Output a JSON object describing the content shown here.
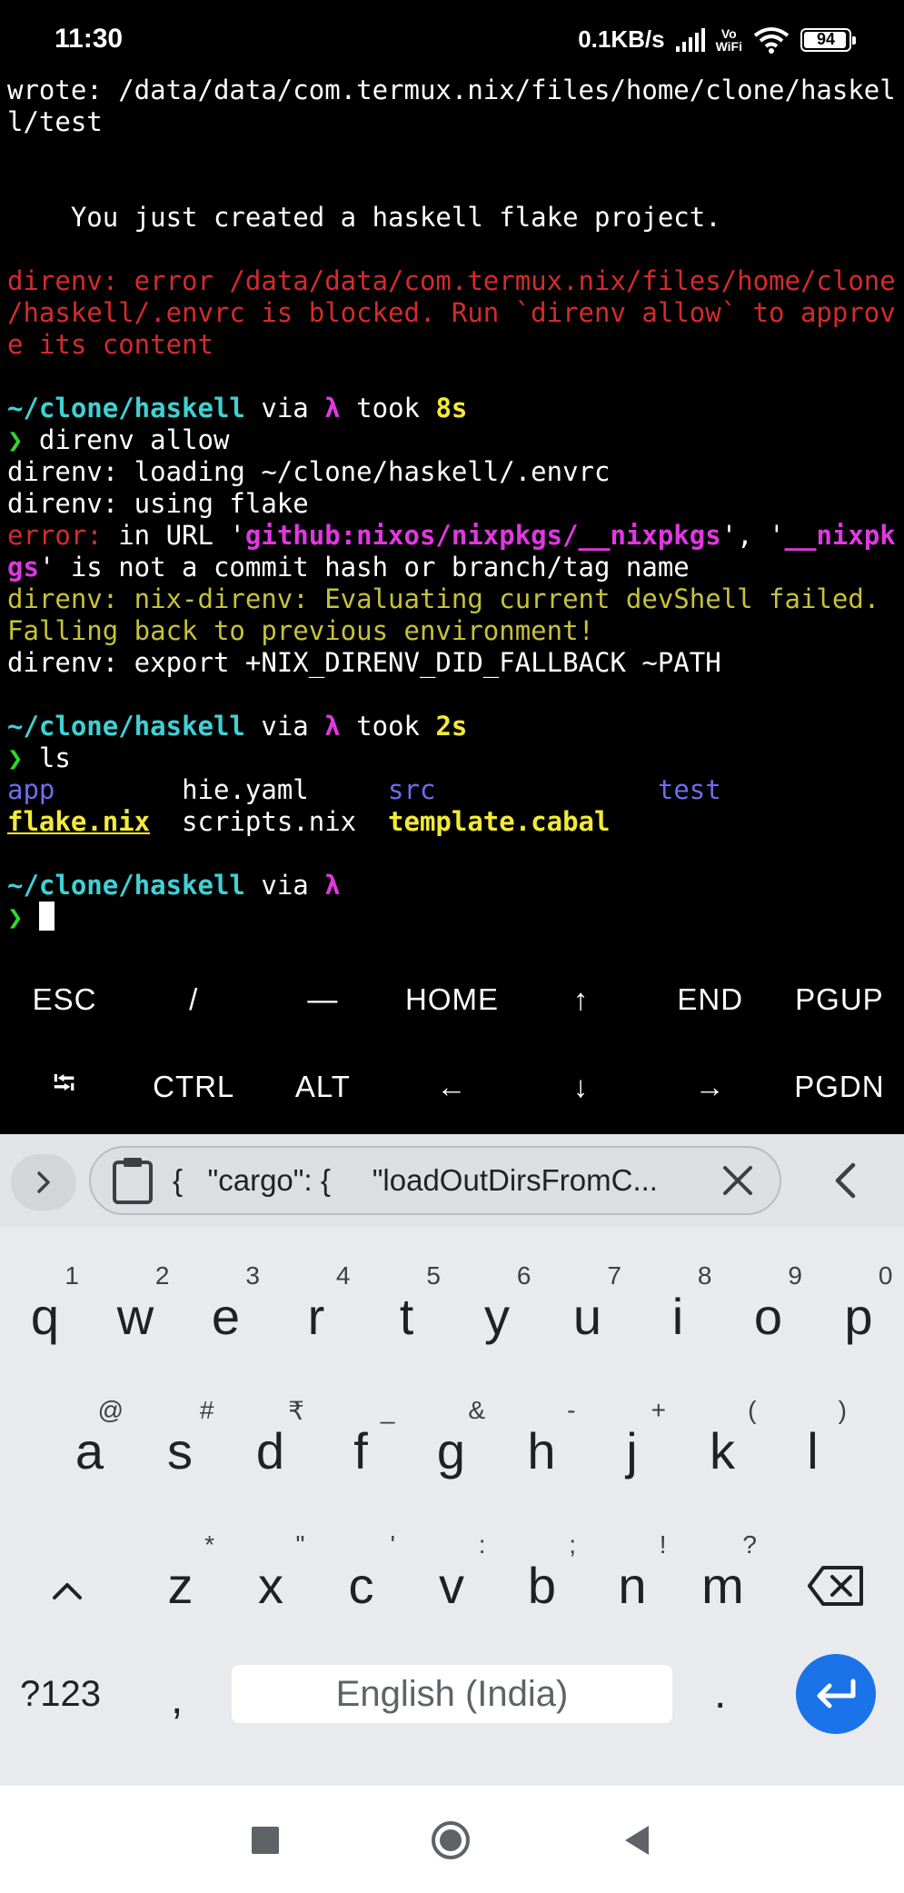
{
  "status_bar": {
    "time": "11:30",
    "net_speed": "0.1KB/s",
    "vowifi_top": "Vo",
    "vowifi_bottom": "WiFi",
    "battery": "94"
  },
  "terminal": {
    "lines": [
      [
        {
          "t": "wrote: /data/data/com.termux.nix/files/home/clone/haskel",
          "c": ""
        }
      ],
      [
        {
          "t": "l/test",
          "c": ""
        }
      ],
      [],
      [],
      [
        {
          "t": "    You just created a haskell flake project.",
          "c": ""
        }
      ],
      [],
      [
        {
          "t": "direnv: error /data/data/com.termux.nix/files/home/clone",
          "c": "c-red"
        }
      ],
      [
        {
          "t": "/haskell/.envrc is blocked. Run `direnv allow` to approv",
          "c": "c-red"
        }
      ],
      [
        {
          "t": "e its content",
          "c": "c-red"
        }
      ],
      [],
      [
        {
          "t": "~/clone/haskell",
          "c": "c-cyan"
        },
        {
          "t": " via ",
          "c": ""
        },
        {
          "t": "λ",
          "c": "c-mag"
        },
        {
          "t": " took ",
          "c": ""
        },
        {
          "t": "8s",
          "c": "c-yel"
        }
      ],
      [
        {
          "t": "❯",
          "c": "c-green"
        },
        {
          "t": " direnv allow",
          "c": ""
        }
      ],
      [
        {
          "t": "direnv: loading ~/clone/haskell/.envrc",
          "c": ""
        }
      ],
      [
        {
          "t": "direnv: using flake",
          "c": ""
        }
      ],
      [
        {
          "t": "error:",
          "c": "c-red"
        },
        {
          "t": " in URL '",
          "c": ""
        },
        {
          "t": "github:nixos/nixpkgs/__nixpkgs",
          "c": "c-mag"
        },
        {
          "t": "', '",
          "c": ""
        },
        {
          "t": "__nixpk",
          "c": "c-mag"
        }
      ],
      [
        {
          "t": "gs",
          "c": "c-mag"
        },
        {
          "t": "' is not a commit hash or branch/tag name",
          "c": ""
        }
      ],
      [
        {
          "t": "direnv: nix-direnv: Evaluating current devShell failed.",
          "c": "c-olive"
        }
      ],
      [
        {
          "t": "Falling back to previous environment!",
          "c": "c-olive"
        }
      ],
      [
        {
          "t": "direnv: export +NIX_DIRENV_DID_FALLBACK ~PATH",
          "c": ""
        }
      ],
      [],
      [
        {
          "t": "~/clone/haskell",
          "c": "c-cyan"
        },
        {
          "t": " via ",
          "c": ""
        },
        {
          "t": "λ",
          "c": "c-mag"
        },
        {
          "t": " took ",
          "c": ""
        },
        {
          "t": "2s",
          "c": "c-yel"
        }
      ],
      [
        {
          "t": "❯",
          "c": "c-green"
        },
        {
          "t": " ls",
          "c": ""
        }
      ],
      [
        {
          "t": "app",
          "c": "c-blue"
        },
        {
          "t": "        hie.yaml     ",
          "c": ""
        },
        {
          "t": "src",
          "c": "c-blue"
        },
        {
          "t": "              ",
          "c": ""
        },
        {
          "t": "test",
          "c": "c-blue"
        }
      ],
      [
        {
          "t": "flake.nix",
          "c": "c-yel c-ul"
        },
        {
          "t": "  scripts.nix  ",
          "c": ""
        },
        {
          "t": "template.cabal",
          "c": "c-yel"
        }
      ],
      [],
      [
        {
          "t": "~/clone/haskell",
          "c": "c-cyan"
        },
        {
          "t": " via ",
          "c": ""
        },
        {
          "t": "λ",
          "c": "c-mag"
        }
      ],
      [
        {
          "t": "❯",
          "c": "c-green"
        },
        {
          "t": " ",
          "c": ""
        },
        {
          "t": "",
          "c": "cursor"
        }
      ]
    ]
  },
  "extra_keys": {
    "row1": [
      "ESC",
      "/",
      "—",
      "HOME",
      "↑",
      "END",
      "PGUP"
    ],
    "row2": [
      "⭾",
      "CTRL",
      "ALT",
      "←",
      "↓",
      "→",
      "PGDN"
    ]
  },
  "keyboard": {
    "clipboard_text": "{   \"cargo\": {     \"loadOutDirsFromC...",
    "row1": [
      {
        "k": "q",
        "h": "1"
      },
      {
        "k": "w",
        "h": "2"
      },
      {
        "k": "e",
        "h": "3"
      },
      {
        "k": "r",
        "h": "4"
      },
      {
        "k": "t",
        "h": "5"
      },
      {
        "k": "y",
        "h": "6"
      },
      {
        "k": "u",
        "h": "7"
      },
      {
        "k": "i",
        "h": "8"
      },
      {
        "k": "o",
        "h": "9"
      },
      {
        "k": "p",
        "h": "0"
      }
    ],
    "row2": [
      {
        "k": "a",
        "h": "@"
      },
      {
        "k": "s",
        "h": "#"
      },
      {
        "k": "d",
        "h": "₹"
      },
      {
        "k": "f",
        "h": "_"
      },
      {
        "k": "g",
        "h": "&"
      },
      {
        "k": "h",
        "h": "-"
      },
      {
        "k": "j",
        "h": "+"
      },
      {
        "k": "k",
        "h": "("
      },
      {
        "k": "l",
        "h": ")"
      }
    ],
    "row3": [
      {
        "k": "z",
        "h": "*"
      },
      {
        "k": "x",
        "h": "\""
      },
      {
        "k": "c",
        "h": "'"
      },
      {
        "k": "v",
        "h": ":"
      },
      {
        "k": "b",
        "h": ";"
      },
      {
        "k": "n",
        "h": "!"
      },
      {
        "k": "m",
        "h": "?"
      }
    ],
    "symbols_label": "?123",
    "comma": ",",
    "space_label": "English (India)",
    "period": "."
  }
}
